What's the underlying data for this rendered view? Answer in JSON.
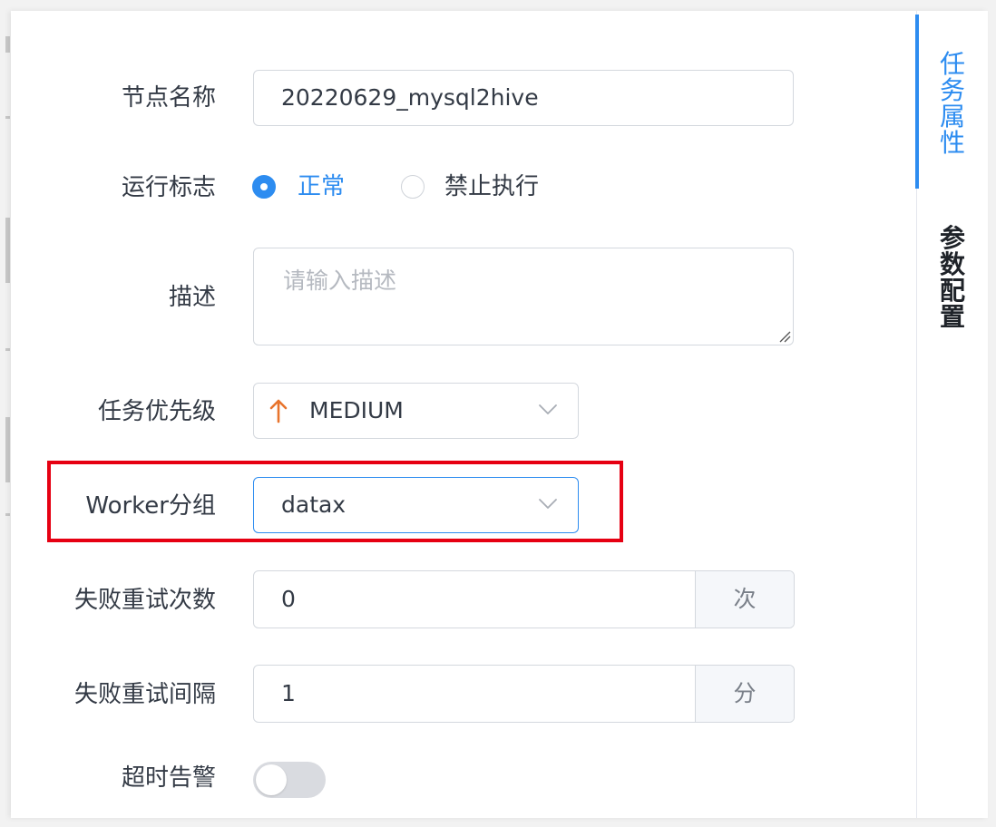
{
  "colors": {
    "accent": "#2d8cf0",
    "highlight_border": "#e60012",
    "priority_arrow": "#e8742d",
    "text": "#333a45",
    "placeholder": "#b5b9c0"
  },
  "form": {
    "node_name": {
      "label": "节点名称",
      "value": "20220629_mysql2hive"
    },
    "run_flag": {
      "label": "运行标志",
      "options": [
        {
          "label": "正常",
          "selected": true
        },
        {
          "label": "禁止执行",
          "selected": false
        }
      ]
    },
    "description": {
      "label": "描述",
      "placeholder": "请输入描述"
    },
    "priority": {
      "label": "任务优先级",
      "value": "MEDIUM",
      "icon": "arrow-up-icon"
    },
    "worker_group": {
      "label": "Worker分组",
      "value": "datax"
    },
    "retry_times": {
      "label": "失败重试次数",
      "value": "0",
      "unit": "次"
    },
    "retry_interval": {
      "label": "失败重试间隔",
      "value": "1",
      "unit": "分"
    },
    "timeout_alarm": {
      "label": "超时告警",
      "enabled": false
    }
  },
  "side_tabs": [
    {
      "label": "任务属性",
      "active": true
    },
    {
      "label": "参数配置",
      "active": false
    }
  ]
}
